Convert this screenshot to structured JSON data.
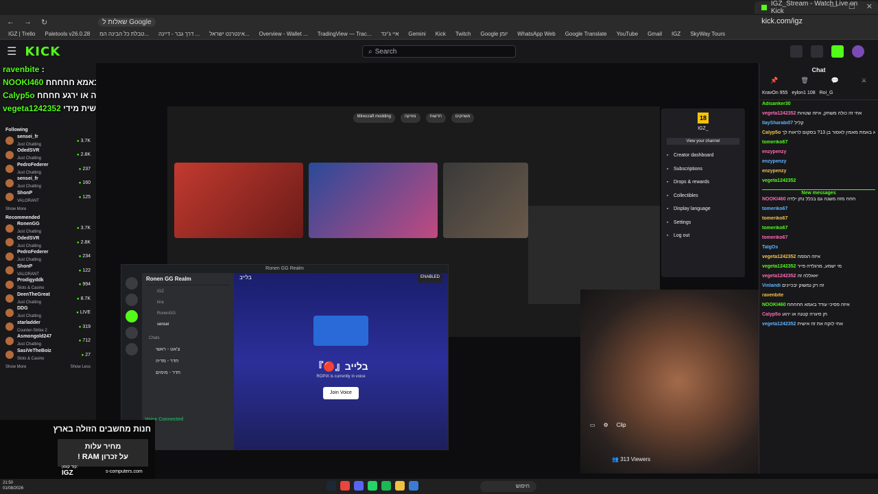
{
  "browser": {
    "tab_title": "IGZ_Stream - Watch Live on Kick",
    "url": "kick.com/igz",
    "extension_label": "שאלות ל Google",
    "bookmarks": [
      "IGZ | Trello",
      "Paletools v26.0.28",
      "טבלת כל הבינה המ...",
      "דרך גבר - דיינה ...",
      "אינטרנט ישראל...",
      "Overview - Wallet ...",
      "TradingView — Trac...",
      "איי ג'ינד",
      "Gemini",
      "Kick",
      "Twitch",
      "Google יומן",
      "WhatsApp Web",
      "Google Translate",
      "YouTube",
      "Gmail",
      "IGZ",
      "SkyWay Tours"
    ]
  },
  "kick": {
    "logo": "KICK",
    "search_placeholder": "Search"
  },
  "sidebar": {
    "following_label": "Following",
    "recommended_label": "Recommended",
    "following": [
      {
        "name": "sensei_fr",
        "cat": "Just Chatting",
        "viewers": "3.7K"
      },
      {
        "name": "OdedSVR",
        "cat": "Just Chatting",
        "viewers": "2.8K"
      },
      {
        "name": "PedroFederer",
        "cat": "Just Chatting",
        "viewers": "237"
      },
      {
        "name": "sensei_fr",
        "cat": "Just Chatting",
        "viewers": "160"
      },
      {
        "name": "ShonP",
        "cat": "VALORANT",
        "viewers": "125"
      }
    ],
    "recommended": [
      {
        "name": "RonenGG",
        "cat": "Just Chatting",
        "viewers": "3.7K"
      },
      {
        "name": "OdedSVR",
        "cat": "Just Chatting",
        "viewers": "2.8K"
      },
      {
        "name": "PedroFederer",
        "cat": "Just Chatting",
        "viewers": "234"
      },
      {
        "name": "ShonP",
        "cat": "VALORANT",
        "viewers": "122"
      },
      {
        "name": "Prodigyddk",
        "cat": "Slots & Casino",
        "viewers": "994"
      },
      {
        "name": "DeenTheGreat",
        "cat": "Just Chatting",
        "viewers": "8.7K"
      },
      {
        "name": "DDG",
        "cat": "Just Chatting",
        "viewers": "LIVE"
      },
      {
        "name": "starladder",
        "cat": "Counter-Strike 2",
        "viewers": "319"
      },
      {
        "name": "Asmongold247",
        "cat": "Just Chatting",
        "viewers": "712"
      },
      {
        "name": "SasiVeTheBoiz",
        "cat": "Slots & Casino",
        "viewers": "27"
      }
    ],
    "show_more": "Show More",
    "show_less": "Show Less"
  },
  "overlay_chat": [
    {
      "user": "ravenbite",
      "text": ":"
    },
    {
      "user": "NOOKI460",
      "text": "איזה פסיכי עודד באמא חחחחח"
    },
    {
      "user": "Calyp5o",
      "text": "תן סיגרה קטנה או ירגע חחחח"
    },
    {
      "user": "vegeta1242352",
      "text": "אחי לוקח את זה אישית מידי :"
    }
  ],
  "kick_menu": {
    "level": "18",
    "name": "IGZ_",
    "view_channel": "View your channel",
    "items": [
      "Creator dashboard",
      "Subscriptions",
      "Drops & rewards",
      "Collectibles",
      "Display language",
      "Settings",
      "Log out"
    ]
  },
  "discord": {
    "window_title": "Ronen GG Realm",
    "server": "Ronen GG Realm",
    "channel": "בלייב",
    "enabled_label": "ENABLED",
    "users": [
      "IGZ",
      "kira",
      "RonenGG",
      "sensei"
    ],
    "chats_label": "Chats",
    "channels": [
      "צ'אט - ראשי",
      "חדר - מדיה",
      "חדר - מימים"
    ],
    "voice_connected": "Voice Connected",
    "big_title": "『🔴』בלייב",
    "subtitle": "ROPIX is currently in voice",
    "join_button": "Join Voice"
  },
  "stream": {
    "viewers": "313 Viewers",
    "clip": "Clip"
  },
  "ad": {
    "headline": "חנות מחשבים הזולה בארץ",
    "offer_line1": "מחיר עלות",
    "offer_line2": "על זכרון RAM !",
    "code_label": "קוד קופון:",
    "code": "IGZ",
    "site": "s-computers.com"
  },
  "chat": {
    "title": "Chat",
    "top_users": [
      "KravOn 955",
      "eylon1 108",
      "Roi_G"
    ],
    "new_messages": "New messages",
    "messages": [
      {
        "user": "Adisanker30",
        "text": ""
      },
      {
        "user": "vegeta1242352",
        "text": "אחי זה כולה משחק, איזה שטויות"
      },
      {
        "user": "IlaySharabi07",
        "text": "קליל"
      },
      {
        "user": "Calyp5o",
        "text": "הוא באמת מאמין לאסור בן 13? בסקום לראות לך"
      },
      {
        "user": "tomeriko67",
        "text": ""
      },
      {
        "user": "enzypenzy",
        "text": ""
      },
      {
        "user": "enzypenzy",
        "text": ""
      },
      {
        "user": "enzypenzy",
        "text": ""
      },
      {
        "user": "vegeta1242352",
        "text": ""
      },
      {
        "user": "NOOKI460",
        "text": "חחח מזה משנה גם בכלל נתן ילדה"
      },
      {
        "user": "tomeriko67",
        "text": ""
      },
      {
        "user": "tomeriko67",
        "text": ""
      },
      {
        "user": "tomeriko67",
        "text": ""
      },
      {
        "user": "tomeriko67",
        "text": ""
      },
      {
        "user": "TalgOs",
        "text": ""
      },
      {
        "user": "vegeta1242352",
        "text": "איזה הגזמה"
      },
      {
        "user": "vegeta1242352",
        "text": "מי ישמע, מרגלדה פייר"
      },
      {
        "user": "vegeta1242352",
        "text": "יאאללה זה"
      },
      {
        "user": "Vinlandi",
        "text": "זה רק נמשוק יבכיינים"
      },
      {
        "user": "ravenbite",
        "text": ""
      },
      {
        "user": "NOOKI460",
        "text": "איזה פסיכי עודד באמא חחחחח"
      },
      {
        "user": "Calyp5o",
        "text": "תן סיגרה קטנה או ירגע"
      },
      {
        "user": "vegeta1242352",
        "text": "אחי לוקח את זה אישית"
      }
    ]
  },
  "taskbar": {
    "search": "חיפוש",
    "time": "21:50",
    "date": "01/08/2026"
  }
}
